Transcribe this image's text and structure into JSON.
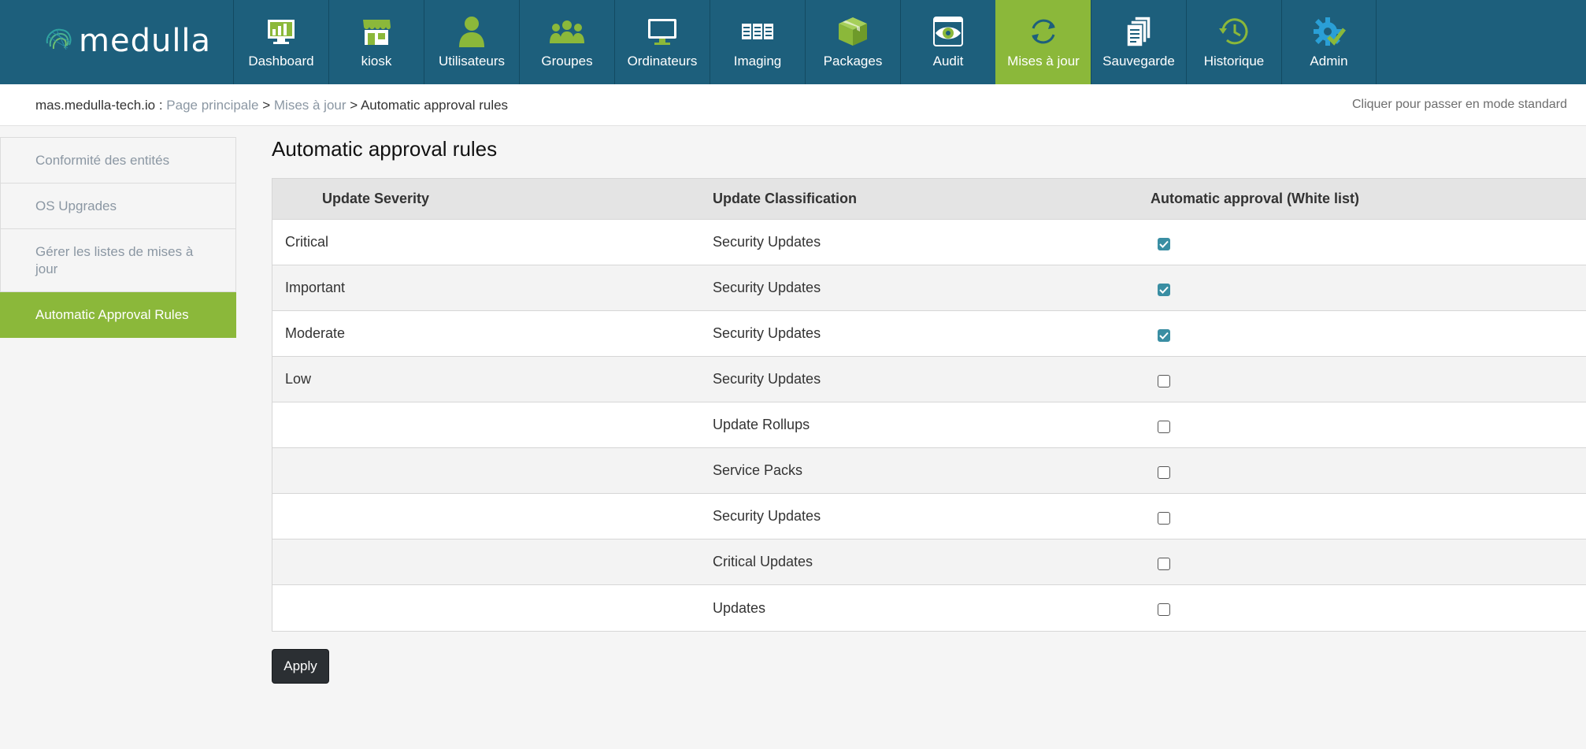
{
  "brand": {
    "name": "medulla"
  },
  "nav": [
    {
      "label": "Dashboard",
      "icon": "dashboard-icon",
      "active": false
    },
    {
      "label": "kiosk",
      "icon": "kiosk-store-icon",
      "active": false
    },
    {
      "label": "Utilisateurs",
      "icon": "user-icon",
      "active": false
    },
    {
      "label": "Groupes",
      "icon": "group-icon",
      "active": false
    },
    {
      "label": "Ordinateurs",
      "icon": "monitor-icon",
      "active": false
    },
    {
      "label": "Imaging",
      "icon": "imaging-icon",
      "active": false
    },
    {
      "label": "Packages",
      "icon": "package-icon",
      "active": false
    },
    {
      "label": "Audit",
      "icon": "audit-eye-icon",
      "active": false
    },
    {
      "label": "Mises à jour",
      "icon": "update-sync-icon",
      "active": true
    },
    {
      "label": "Sauvegarde",
      "icon": "backup-documents-icon",
      "active": false
    },
    {
      "label": "Historique",
      "icon": "history-clock-icon",
      "active": false
    },
    {
      "label": "Admin",
      "icon": "admin-gear-icon",
      "active": false
    }
  ],
  "breadcrumb": {
    "host": "mas.medulla-tech.io",
    "sep1": " : ",
    "home": "Page principale",
    "sep2": " > ",
    "section": "Mises à jour",
    "sep3": " > ",
    "current": "Automatic approval rules"
  },
  "mode_link": "Cliquer pour passer en mode standard",
  "sidebar": {
    "items": [
      {
        "label": "Conformité des entités",
        "active": false
      },
      {
        "label": "OS Upgrades",
        "active": false
      },
      {
        "label": "Gérer les listes de mises à jour",
        "active": false
      },
      {
        "label": "Automatic Approval Rules",
        "active": true
      }
    ]
  },
  "page": {
    "title": "Automatic approval rules"
  },
  "table": {
    "headers": [
      "Update Severity",
      "Update Classification",
      "Automatic approval (White list)"
    ],
    "rows": [
      {
        "severity": "Critical",
        "classification": "Security Updates",
        "approved": true
      },
      {
        "severity": "Important",
        "classification": "Security Updates",
        "approved": true
      },
      {
        "severity": "Moderate",
        "classification": "Security Updates",
        "approved": true
      },
      {
        "severity": "Low",
        "classification": "Security Updates",
        "approved": false
      },
      {
        "severity": "",
        "classification": "Update Rollups",
        "approved": false
      },
      {
        "severity": "",
        "classification": "Service Packs",
        "approved": false
      },
      {
        "severity": "",
        "classification": "Security Updates",
        "approved": false
      },
      {
        "severity": "",
        "classification": "Critical Updates",
        "approved": false
      },
      {
        "severity": "",
        "classification": "Updates",
        "approved": false
      }
    ]
  },
  "apply_label": "Apply",
  "colors": {
    "topbar": "#1d5f7c",
    "accent_green": "#8bb83a",
    "checkbox_checked": "#3a8ea3",
    "link_gray": "#8b97a3"
  }
}
